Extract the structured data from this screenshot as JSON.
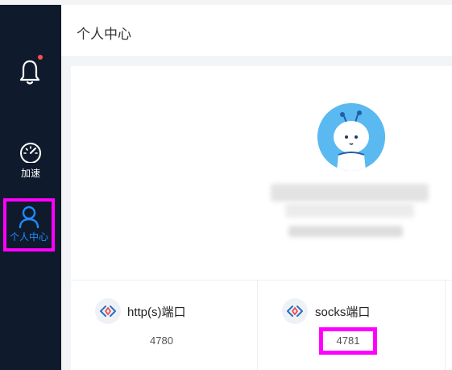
{
  "sidebar": {
    "items": [
      {
        "label": "加速"
      },
      {
        "label": "个人中心"
      }
    ]
  },
  "page": {
    "title": "个人中心"
  },
  "ports": {
    "http": {
      "label": "http(s)端口",
      "value": "4780"
    },
    "socks": {
      "label": "socks端口",
      "value": "4781"
    }
  },
  "colors": {
    "sidebar_bg": "#0f1b2c",
    "active_blue": "#1f8bff",
    "highlight": "#ff00ff",
    "notification_dot": "#ff4d4f"
  },
  "icons": {
    "bell": "bell-icon",
    "accelerate": "speedometer-icon",
    "profile": "user-icon",
    "port": "code-brackets-icon"
  }
}
